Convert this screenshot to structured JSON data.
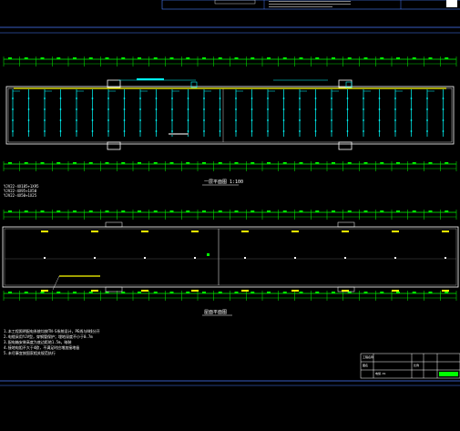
{
  "drawing": {
    "plan1_title": "一层平面图 1:100",
    "plan2_title": "屋面平面图",
    "legend": [
      "YJV22-4X185+1X95",
      "YJV22-4X95+1X50",
      "YJV22-4X50+1X25"
    ],
    "notes": [
      "1.本工程照明配电系统均按TN-S系统设计，PE线与N线分开",
      "2.电缆采用YJV型，穿钢管保护；埋地深度不小于0.7m",
      "3.配电箱安装高度为底边距地1.5m，暗装",
      "4.接地电阻不大于4欧，不满足时应增加接地极",
      "5.未尽事宜按国家相关规范执行"
    ],
    "title_block": {
      "project_label": "工程名称",
      "drawing_label": "图名",
      "scale_label": "比例",
      "drawing_no": "电施-01"
    }
  },
  "colors": {
    "background": "#000000",
    "axis_green": "#00ff00",
    "wall_white": "#ffffff",
    "circuit_cyan": "#00ffff",
    "marker_yellow": "#ffff00",
    "accent_blue": "#4a7dff"
  }
}
